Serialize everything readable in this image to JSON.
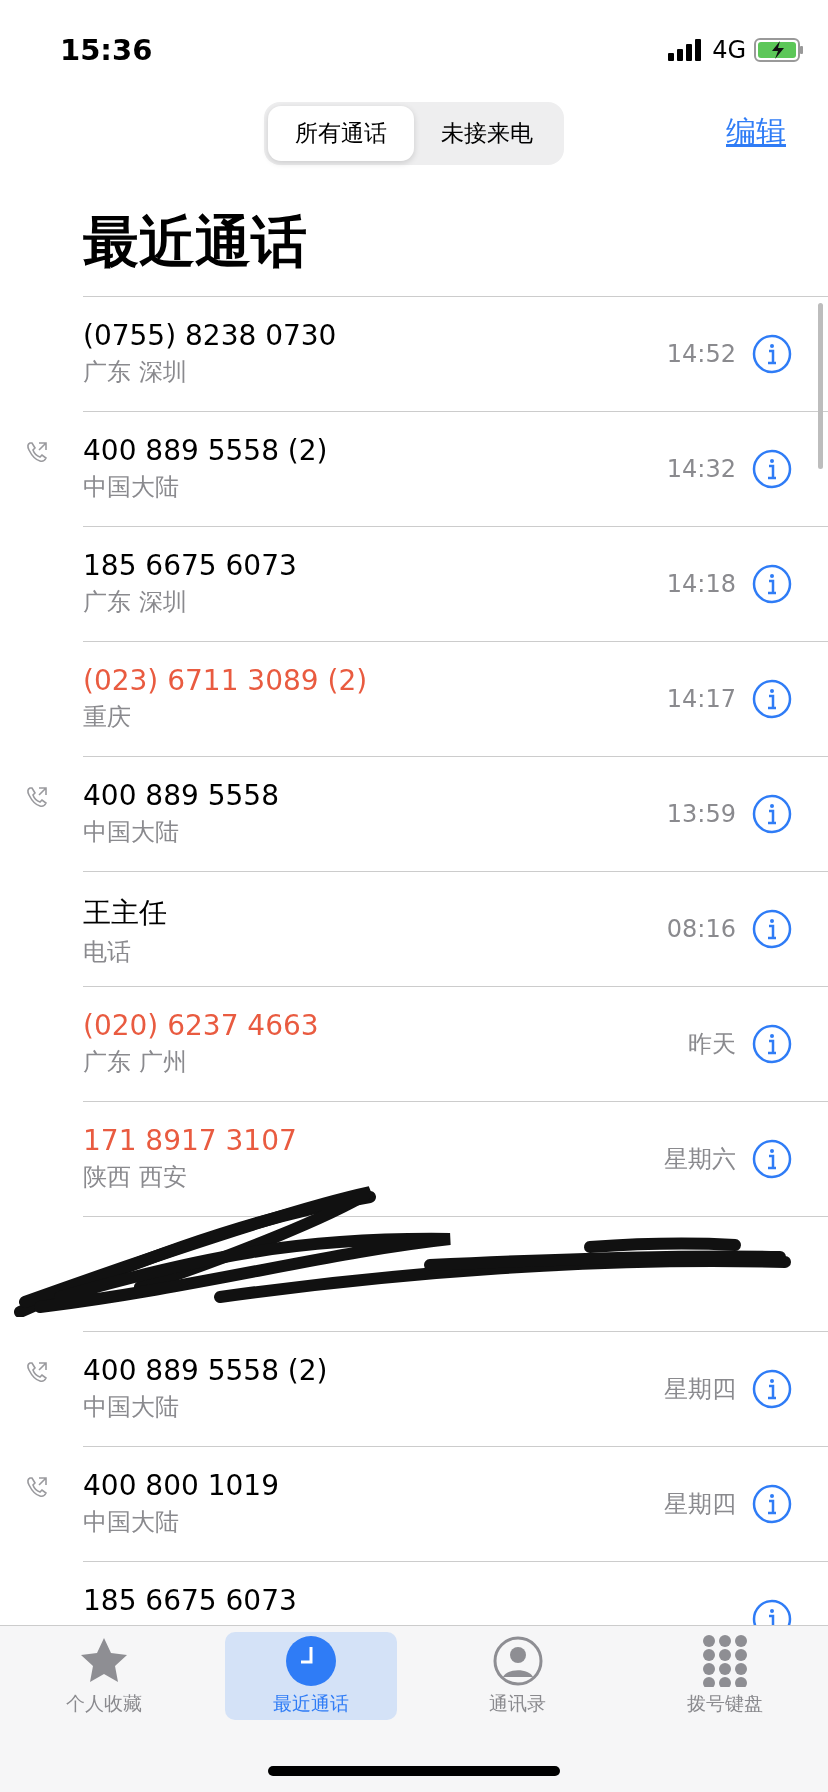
{
  "status_bar": {
    "time": "15:36",
    "network": "4G"
  },
  "segments": [
    {
      "label": "所有通话",
      "selected": true
    },
    {
      "label": "未接来电",
      "selected": false
    }
  ],
  "edit_link": "编辑",
  "title": "最近通话",
  "calls": [
    {
      "number": "(0755) 8238 0730",
      "location": "广东 深圳",
      "time": "14:52",
      "missed": false,
      "outgoing": false
    },
    {
      "number": "400 889 5558 (2)",
      "location": "中国大陆",
      "time": "14:32",
      "missed": false,
      "outgoing": true
    },
    {
      "number": "185 6675 6073",
      "location": "广东 深圳",
      "time": "14:18",
      "missed": false,
      "outgoing": false
    },
    {
      "number": "(023) 6711 3089 (2)",
      "location": "重庆",
      "time": "14:17",
      "missed": true,
      "outgoing": false
    },
    {
      "number": "400 889 5558",
      "location": "中国大陆",
      "time": "13:59",
      "missed": false,
      "outgoing": true
    },
    {
      "number": "王主任",
      "location": "电话",
      "time": "08:16",
      "missed": false,
      "outgoing": false
    },
    {
      "number": "(020) 6237 4663",
      "location": "广东 广州",
      "time": "昨天",
      "missed": true,
      "outgoing": false
    },
    {
      "number": "171 8917 3107",
      "location": "陕西 西安",
      "time": "星期六",
      "missed": true,
      "outgoing": false
    },
    {
      "kind": "redacted"
    },
    {
      "number": "400 889 5558 (2)",
      "location": "中国大陆",
      "time": "星期四",
      "missed": false,
      "outgoing": true
    },
    {
      "number": "400 800 1019",
      "location": "中国大陆",
      "time": "星期四",
      "missed": false,
      "outgoing": true
    },
    {
      "number": "185 6675 6073",
      "missed": false,
      "outgoing": false
    }
  ],
  "tabs": [
    {
      "kind": "star",
      "label": "个人收藏",
      "selected": false
    },
    {
      "kind": "clock",
      "label": "最近通话",
      "selected": true
    },
    {
      "kind": "contact",
      "label": "通讯录",
      "selected": false
    },
    {
      "kind": "keypad",
      "label": "拨号键盘",
      "selected": false
    }
  ]
}
